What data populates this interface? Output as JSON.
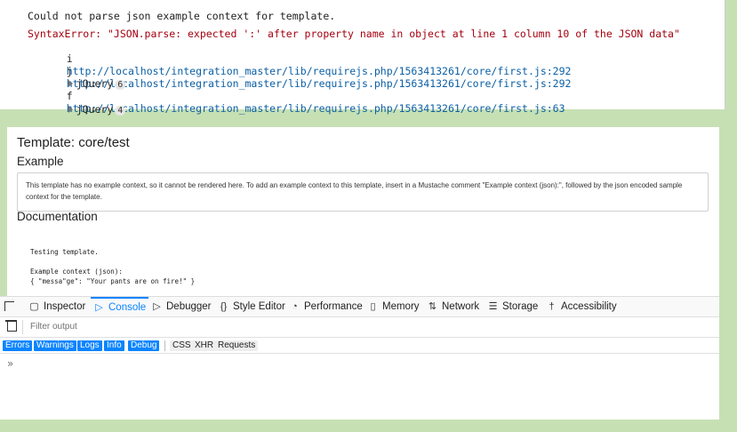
{
  "console_output": {
    "message": "Could not parse json example context for template.",
    "error": "SyntaxError: \"JSON.parse: expected ':' after property name in object at line 1 column 10 of the JSON data\"",
    "stack": [
      {
        "fn": "i",
        "link": "http://localhost/integration_master/lib/requirejs.php/1563413261/core/first.js:292"
      },
      {
        "fn": "j",
        "link": "http://localhost/integration_master/lib/requirejs.php/1563413261/core/first.js:292"
      },
      {
        "group": "jQuery",
        "count": "6"
      },
      {
        "fn": "f",
        "link": "http://localhost/integration_master/lib/requirejs.php/1563413261/core/first.js:63"
      },
      {
        "group": "jQuery",
        "count": "4"
      }
    ]
  },
  "template": {
    "title": "Template: core/test",
    "example_heading": "Example",
    "example_text": "This template has no example context, so it cannot be rendered here. To add an example context to this template, insert in a Mustache comment \"Example context (json):\", followed by the json encoded sample context for the template.",
    "documentation_heading": "Documentation",
    "doc_lines": [
      "Testing template.",
      "Example context (json):",
      "{ \"messa\"ge\": \"Your pants are on fire!\" }"
    ]
  },
  "devtools": {
    "tabs": [
      {
        "label": "Inspector",
        "icon": "inspector-icon"
      },
      {
        "label": "Console",
        "icon": "console-icon",
        "active": true
      },
      {
        "label": "Debugger",
        "icon": "debugger-icon"
      },
      {
        "label": "Style Editor",
        "icon": "style-editor-icon"
      },
      {
        "label": "Performance",
        "icon": "performance-icon"
      },
      {
        "label": "Memory",
        "icon": "memory-icon"
      },
      {
        "label": "Network",
        "icon": "network-icon"
      },
      {
        "label": "Storage",
        "icon": "storage-icon"
      },
      {
        "label": "Accessibility",
        "icon": "accessibility-icon"
      }
    ],
    "filter_placeholder": "Filter output",
    "categories_on": [
      "Errors",
      "Warnings",
      "Logs",
      "Info",
      "Debug"
    ],
    "categories_off": [
      "CSS",
      "XHR",
      "Requests"
    ],
    "prompt": "»"
  },
  "colors": {
    "accent": "#0a84ff",
    "error": "#a4000f",
    "link": "#0b5fa5",
    "page_bg": "#c6e0b4"
  }
}
